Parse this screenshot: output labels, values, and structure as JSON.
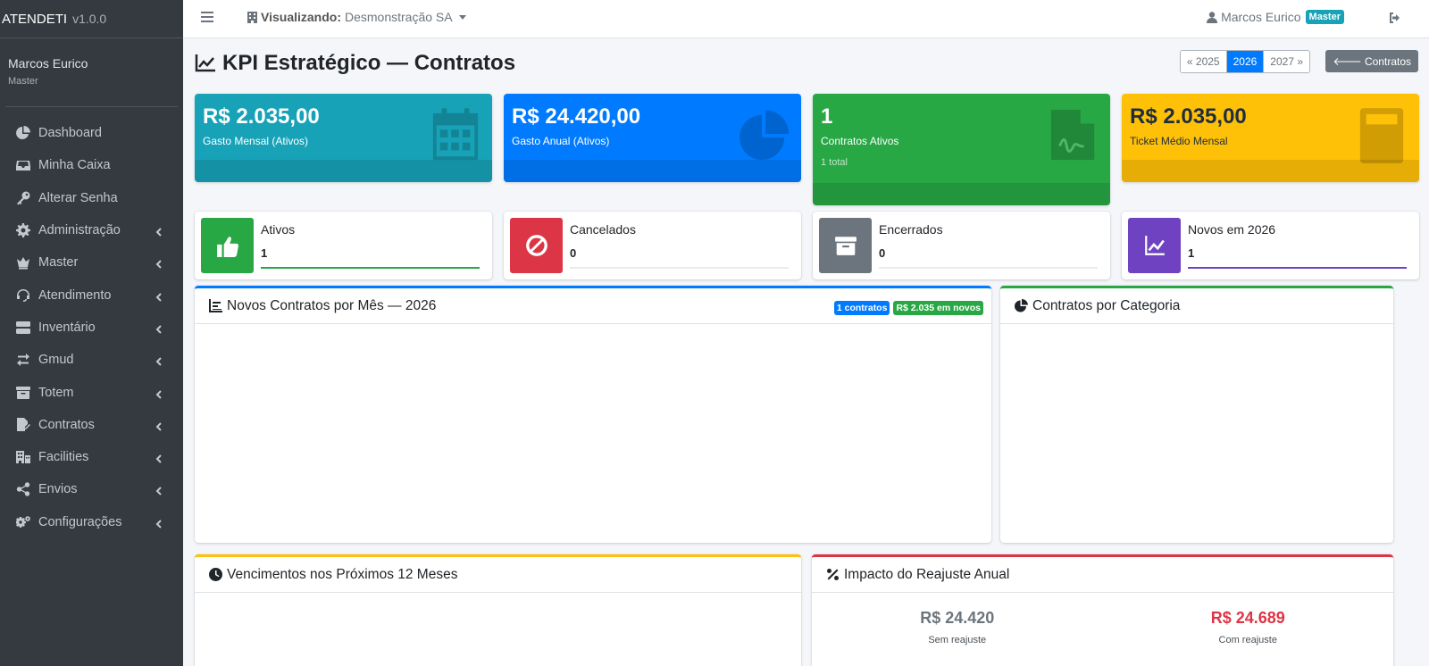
{
  "brand": {
    "name": "ATENDETI",
    "version": "v1.0.0"
  },
  "user": {
    "name": "Marcos Eurico",
    "role": "Master"
  },
  "sidebar": {
    "items": [
      {
        "label": "Dashboard",
        "icon": "chart-pie-icon",
        "has_caret": false
      },
      {
        "label": "Minha Caixa",
        "icon": "inbox-icon",
        "has_caret": false
      },
      {
        "label": "Alterar Senha",
        "icon": "key-icon",
        "has_caret": false
      },
      {
        "label": "Administração",
        "icon": "gear-icon",
        "has_caret": true
      },
      {
        "label": "Master",
        "icon": "crown-icon",
        "has_caret": true
      },
      {
        "label": "Atendimento",
        "icon": "headset-icon",
        "has_caret": true
      },
      {
        "label": "Inventário",
        "icon": "server-icon",
        "has_caret": true
      },
      {
        "label": "Gmud",
        "icon": "exchange-icon",
        "has_caret": true
      },
      {
        "label": "Totem",
        "icon": "archive-icon",
        "has_caret": true
      },
      {
        "label": "Contratos",
        "icon": "file-signature-icon",
        "has_caret": true
      },
      {
        "label": "Facilities",
        "icon": "building-icon",
        "has_caret": true
      },
      {
        "label": "Envios",
        "icon": "share-icon",
        "has_caret": true
      },
      {
        "label": "Configurações",
        "icon": "cogs-icon",
        "has_caret": true
      }
    ]
  },
  "topbar": {
    "view_prefix": "Visualizando:",
    "view_value": "Desmonstração SA",
    "user_name": "Marcos Eurico",
    "user_badge": "Master"
  },
  "page": {
    "title": "KPI Estratégico — Contratos",
    "years": {
      "prev": "« 2025",
      "current": "2026",
      "next": "2027 »"
    },
    "back_label": "Contratos"
  },
  "summary": [
    {
      "value": "R$ 2.035,00",
      "label": "Gasto Mensal (Ativos)",
      "sub": "",
      "color": "#17a2b8",
      "icon": "calendar-icon"
    },
    {
      "value": "R$ 24.420,00",
      "label": "Gasto Anual (Ativos)",
      "sub": "",
      "color": "#007bff",
      "icon": "pie-chart-icon"
    },
    {
      "value": "1",
      "label": "Contratos Ativos",
      "sub": "1 total",
      "color": "#28a745",
      "icon": "file-contract-icon"
    },
    {
      "value": "R$ 2.035,00",
      "label": "Ticket Médio Mensal",
      "sub": "",
      "color": "#ffc107",
      "icon": "calculator-icon"
    }
  ],
  "status": [
    {
      "label": "Ativos",
      "value": "1",
      "color": "#28a745",
      "bar_color": "#28a745",
      "progress": 1,
      "icon": "thumbs-up-icon"
    },
    {
      "label": "Cancelados",
      "value": "0",
      "color": "#dc3545",
      "bar_color": "#dc3545",
      "progress": 0,
      "icon": "ban-icon"
    },
    {
      "label": "Encerrados",
      "value": "0",
      "color": "#6c757d",
      "bar_color": "#6c757d",
      "progress": 0,
      "icon": "archive-icon"
    },
    {
      "label": "Novos em 2026",
      "value": "1",
      "color": "#6f42c1",
      "bar_color": "#6f42c1",
      "progress": 1,
      "icon": "chart-line-icon"
    }
  ],
  "cards": {
    "monthly": {
      "title": "Novos Contratos por Mês — 2026",
      "badge_count": "1 contratos",
      "badge_value": "R$ 2.035 em novos"
    },
    "category": {
      "title": "Contratos por Categoria"
    },
    "due": {
      "title": "Vencimentos nos Próximos 12 Meses"
    },
    "adjust": {
      "title": "Impacto do Reajuste Anual",
      "without_value": "R$ 24.420",
      "without_label": "Sem reajuste",
      "with_value": "R$ 24.689",
      "with_label": "Com reajuste"
    }
  }
}
